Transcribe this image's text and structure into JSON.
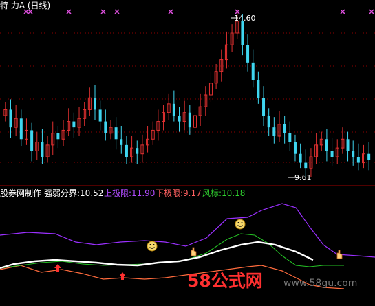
{
  "window": {
    "title": "特 力A (日线)"
  },
  "main_chart": {
    "high_label": "14.60",
    "low_label": "9.61"
  },
  "indicator": {
    "name": "股券网制作",
    "strong_weak": "强弱分界:10.52",
    "upper": "上极限:11.90",
    "lower": "下极限:9.17",
    "wind": "风标:10.18"
  },
  "watermark": {
    "big": "58公式网",
    "small": "www.58gu.com"
  },
  "colors": {
    "up": "#e03030",
    "down": "#3fd6f0",
    "upper_line": "#9b30ff",
    "lower_line": "#ff6b3d",
    "wind_line": "#25c025",
    "strong_line": "#ffffff",
    "marker": "#e050e0",
    "grid": "#8b0000"
  },
  "chart_data": {
    "type": "candlestick",
    "title": "特 力A (日线)",
    "price_labels": {
      "high": 14.6,
      "low": 9.61
    },
    "candles_approx": [
      [
        11.4,
        11.6
      ],
      [
        11.6,
        11.0
      ],
      [
        11.0,
        11.3
      ],
      [
        11.3,
        10.6
      ],
      [
        10.6,
        10.9
      ],
      [
        10.9,
        10.2
      ],
      [
        10.2,
        10.5
      ],
      [
        10.5,
        10.0
      ],
      [
        10.0,
        10.4
      ],
      [
        10.4,
        10.8
      ],
      [
        10.8,
        10.6
      ],
      [
        10.6,
        10.9
      ],
      [
        10.9,
        11.2
      ],
      [
        11.2,
        11.0
      ],
      [
        11.0,
        11.3
      ],
      [
        11.3,
        11.6
      ],
      [
        11.6,
        12.0
      ],
      [
        12.0,
        11.6
      ],
      [
        11.6,
        11.2
      ],
      [
        11.2,
        10.8
      ],
      [
        10.8,
        11.0
      ],
      [
        11.0,
        10.6
      ],
      [
        10.6,
        10.4
      ],
      [
        10.4,
        10.0
      ],
      [
        10.0,
        10.3
      ],
      [
        10.3,
        10.1
      ],
      [
        10.1,
        10.4
      ],
      [
        10.4,
        10.6
      ],
      [
        10.6,
        10.9
      ],
      [
        10.9,
        11.2
      ],
      [
        11.2,
        11.5
      ],
      [
        11.5,
        11.8
      ],
      [
        11.8,
        11.4
      ],
      [
        11.4,
        11.2
      ],
      [
        11.2,
        11.5
      ],
      [
        11.5,
        11.0
      ],
      [
        11.0,
        11.4
      ],
      [
        11.4,
        11.7
      ],
      [
        11.7,
        12.1
      ],
      [
        12.1,
        12.5
      ],
      [
        12.5,
        12.9
      ],
      [
        12.9,
        13.3
      ],
      [
        13.3,
        13.8
      ],
      [
        13.8,
        14.2
      ],
      [
        14.2,
        14.6
      ],
      [
        14.6,
        13.8
      ],
      [
        13.8,
        13.2
      ],
      [
        13.2,
        12.6
      ],
      [
        12.6,
        12.0
      ],
      [
        12.0,
        11.4
      ],
      [
        11.4,
        11.0
      ],
      [
        11.0,
        10.7
      ],
      [
        10.7,
        11.1
      ],
      [
        11.1,
        10.8
      ],
      [
        10.8,
        10.5
      ],
      [
        10.5,
        10.1
      ],
      [
        10.1,
        9.8
      ],
      [
        9.8,
        9.6
      ],
      [
        9.6,
        10.0
      ],
      [
        10.0,
        10.4
      ],
      [
        10.4,
        10.6
      ],
      [
        10.6,
        10.2
      ],
      [
        10.2,
        10.0
      ],
      [
        10.0,
        10.3
      ],
      [
        10.3,
        10.6
      ],
      [
        10.6,
        10.2
      ],
      [
        10.2,
        10.0
      ],
      [
        10.0,
        9.8
      ],
      [
        9.8,
        10.1
      ],
      [
        10.1,
        9.9
      ]
    ]
  }
}
